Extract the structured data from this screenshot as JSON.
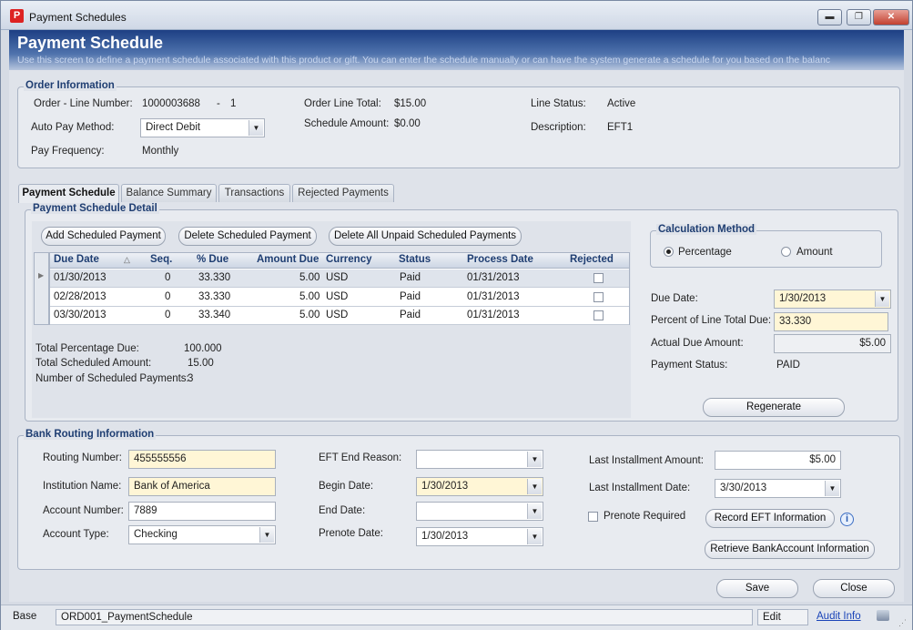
{
  "window": {
    "title": "Payment Schedules",
    "logo": "P"
  },
  "header": {
    "title": "Payment Schedule",
    "description": "Use this screen to define a payment schedule associated with this product or gift. You can enter the schedule manually or can have the system generate a schedule for you based on the balanc"
  },
  "order_info": {
    "group_title": "Order Information",
    "order_line_label": "Order - Line Number:",
    "order_number": "1000003688",
    "dash": "-",
    "line_number": "1",
    "auto_pay_label": "Auto Pay Method:",
    "auto_pay_value": "Direct Debit",
    "pay_freq_label": "Pay Frequency:",
    "pay_freq_value": "Monthly",
    "order_line_total_label": "Order Line Total:",
    "order_line_total_value": "$15.00",
    "schedule_amount_label": "Schedule Amount:",
    "schedule_amount_value": "$0.00",
    "line_status_label": "Line Status:",
    "line_status_value": "Active",
    "description_label": "Description:",
    "description_value": "EFT1"
  },
  "tabs": [
    "Payment Schedule",
    "Balance Summary",
    "Transactions",
    "Rejected Payments"
  ],
  "schedule_detail": {
    "group_title": "Payment Schedule Detail",
    "buttons": {
      "add": "Add Scheduled Payment",
      "delete": "Delete Scheduled Payment",
      "delete_all": "Delete All Unpaid Scheduled Payments"
    },
    "columns": {
      "due_date": "Due Date",
      "seq": "Seq.",
      "pct_due": "% Due",
      "amount_due": "Amount Due",
      "currency": "Currency",
      "status": "Status",
      "process_date": "Process Date",
      "rejected": "Rejected"
    },
    "rows": [
      {
        "due_date": "01/30/2013",
        "seq": "0",
        "pct_due": "33.330",
        "amount_due": "5.00",
        "currency": "USD",
        "status": "Paid",
        "process_date": "01/31/2013",
        "rejected": false
      },
      {
        "due_date": "02/28/2013",
        "seq": "0",
        "pct_due": "33.330",
        "amount_due": "5.00",
        "currency": "USD",
        "status": "Paid",
        "process_date": "01/31/2013",
        "rejected": false
      },
      {
        "due_date": "03/30/2013",
        "seq": "0",
        "pct_due": "33.340",
        "amount_due": "5.00",
        "currency": "USD",
        "status": "Paid",
        "process_date": "01/31/2013",
        "rejected": false
      }
    ],
    "totals": {
      "total_pct_label": "Total Percentage Due:",
      "total_pct_value": "100.000",
      "total_amt_label": "Total Scheduled Amount:",
      "total_amt_value": "15.00",
      "num_payments_label": "Number of Scheduled Payments:",
      "num_payments_value": "3"
    },
    "calc_method": {
      "title": "Calculation Method",
      "percentage": "Percentage",
      "amount": "Amount",
      "selected": "Percentage"
    },
    "detail": {
      "due_date_label": "Due Date:",
      "due_date_value": "1/30/2013",
      "percent_label": "Percent of Line Total Due:",
      "percent_value": "33.330",
      "actual_label": "Actual Due Amount:",
      "actual_value": "$5.00",
      "status_label": "Payment Status:",
      "status_value": "PAID",
      "regenerate": "Regenerate"
    }
  },
  "bank": {
    "group_title": "Bank Routing Information",
    "routing_label": "Routing Number:",
    "routing_value": "455555556",
    "institution_label": "Institution Name:",
    "institution_value": "Bank of America",
    "account_label": "Account Number:",
    "account_value": "7889",
    "type_label": "Account Type:",
    "type_value": "Checking",
    "eft_end_label": "EFT End Reason:",
    "eft_end_value": "",
    "begin_label": "Begin Date:",
    "begin_value": "1/30/2013",
    "end_label": "End Date:",
    "end_value": "",
    "prenote_date_label": "Prenote Date:",
    "prenote_date_value": "1/30/2013",
    "last_amt_label": "Last Installment Amount:",
    "last_amt_value": "$5.00",
    "last_date_label": "Last Installment Date:",
    "last_date_value": "3/30/2013",
    "prenote_required_label": "Prenote Required",
    "record_eft": "Record EFT Information",
    "retrieve": "Retrieve BankAccount Information"
  },
  "footer": {
    "save": "Save",
    "close": "Close"
  },
  "statusbar": {
    "mode": "Base",
    "form": "ORD001_PaymentSchedule",
    "state": "Edit",
    "audit": "Audit Info"
  }
}
